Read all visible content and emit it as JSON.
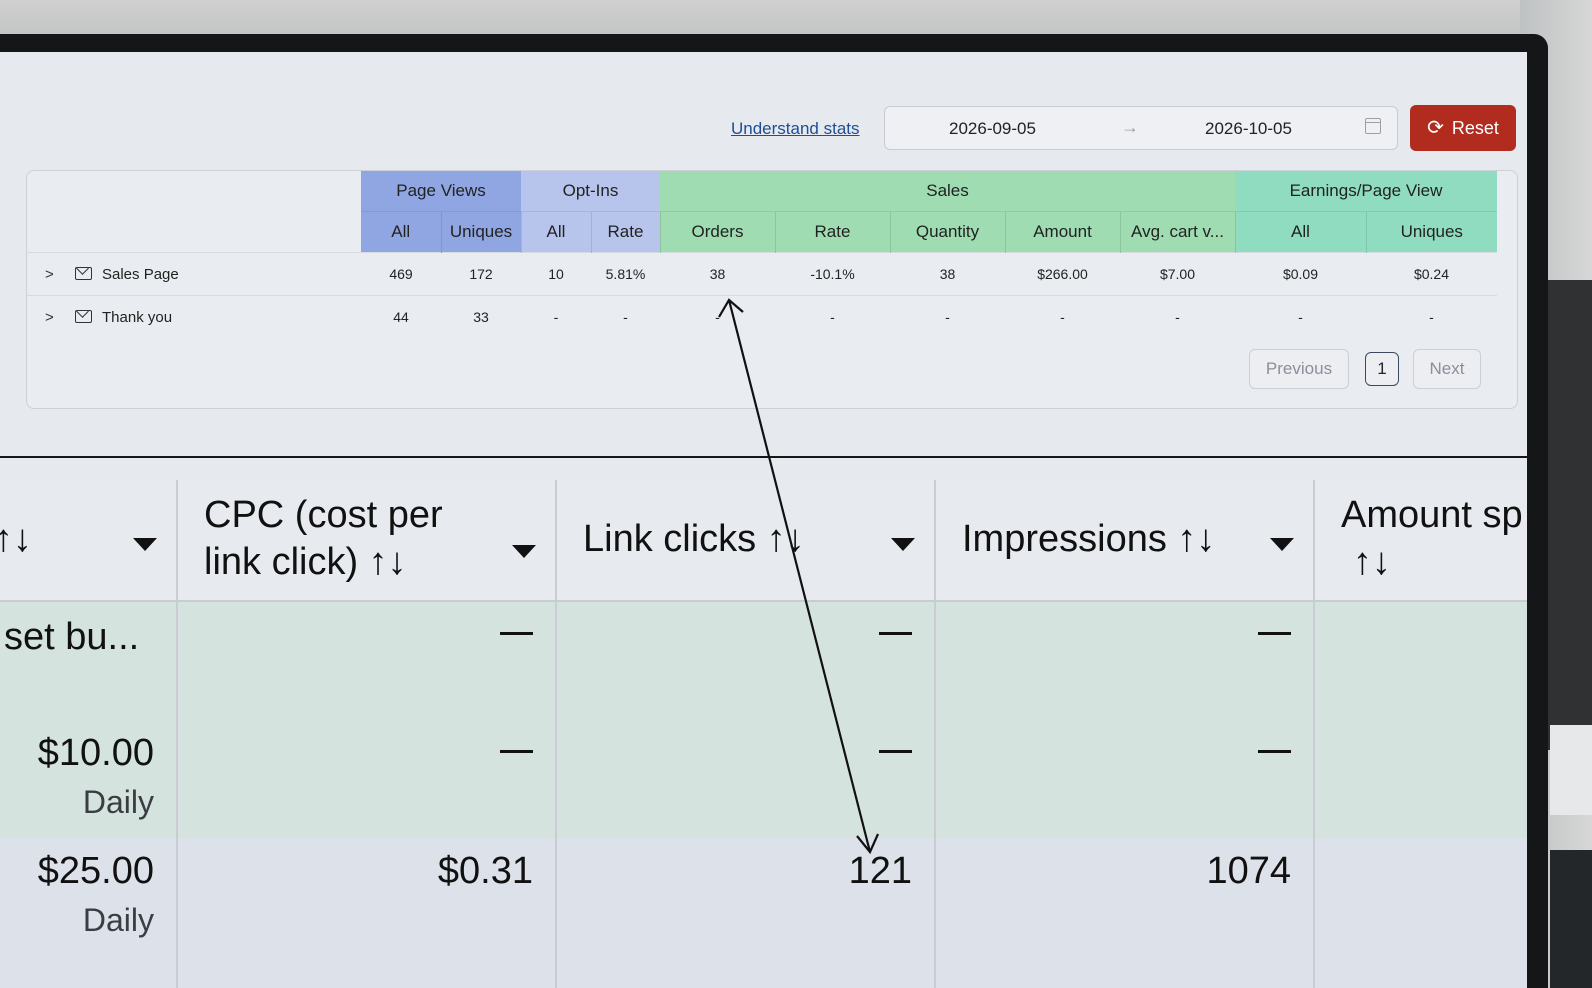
{
  "stats": {
    "understand_link": "Understand stats",
    "date_start": "2026-09-05",
    "date_end": "2026-10-05",
    "date_arrow": "→",
    "reset_label": "Reset",
    "reset_icon": "refresh-icon",
    "groups": [
      {
        "label": "Page Views",
        "color": "#8fa6e3"
      },
      {
        "label": "Opt-Ins",
        "color": "#b7c4ec"
      },
      {
        "label": "Sales",
        "color": "#9fdcb2"
      },
      {
        "label": "Earnings/Page View",
        "color": "#8fdcc0"
      }
    ],
    "subheaders": [
      "All",
      "Uniques",
      "All",
      "Rate",
      "Orders",
      "Rate",
      "Quantity",
      "Amount",
      "Avg. cart v...",
      "All",
      "Uniques"
    ],
    "rows": [
      {
        "name": "Sales Page",
        "icon": "mail-icon",
        "values": [
          "469",
          "172",
          "10",
          "5.81%",
          "38",
          "-10.1%",
          "38",
          "$266.00",
          "$7.00",
          "$0.09",
          "$0.24"
        ]
      },
      {
        "name": "Thank you",
        "icon": "mail-icon",
        "values": [
          "44",
          "33",
          "-",
          "-",
          "-",
          "-",
          "-",
          "-",
          "-",
          "-",
          "-"
        ]
      }
    ],
    "pagination": {
      "previous": "Previous",
      "page": "1",
      "next": "Next"
    }
  },
  "ads": {
    "first_col_header_icon": "↑↓",
    "headers": [
      {
        "line1": "CPC (cost per",
        "line2": "link click) ↑↓"
      },
      {
        "line1": "Link clicks ↑↓"
      },
      {
        "line1": "Impressions ↑↓"
      },
      {
        "line1": "Amount sp",
        "line2": "↑↓"
      }
    ],
    "row1": {
      "first": "set bu...",
      "cpc": "—",
      "clicks": "—",
      "impressions": "—"
    },
    "row2": {
      "budget": "$10.00",
      "budget_period": "Daily",
      "cpc": "—",
      "clicks": "—",
      "impressions": "—"
    },
    "row3": {
      "budget": "$25.00",
      "budget_period": "Daily",
      "cpc": "$0.31",
      "clicks": "121",
      "impressions": "1074"
    }
  },
  "colors": {
    "accent_reset": "#b22b1f",
    "link": "#1d4e97",
    "row_green": "#d4e3dd"
  }
}
